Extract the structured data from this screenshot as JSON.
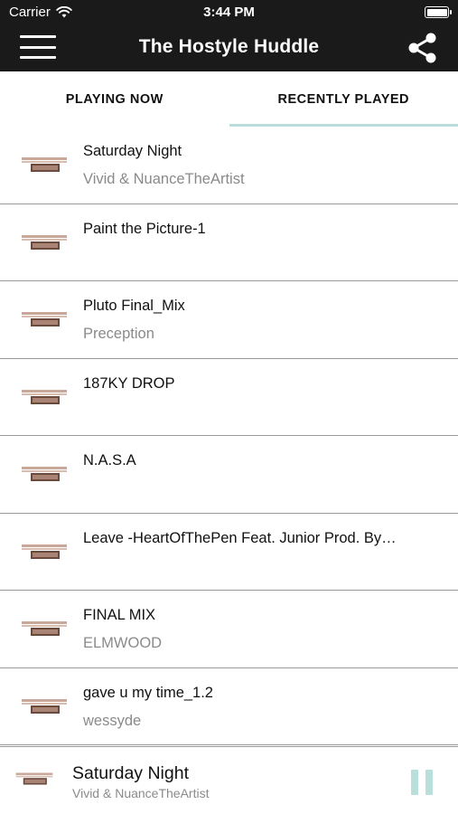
{
  "status_bar": {
    "carrier": "Carrier",
    "time": "3:44 PM",
    "icons": {
      "wifi": "wifi-icon",
      "battery": "battery-icon"
    }
  },
  "nav": {
    "title": "The Hostyle Huddle",
    "menu_icon": "menu-icon",
    "share_icon": "share-icon"
  },
  "tabs": [
    {
      "label": "PLAYING NOW",
      "active": false
    },
    {
      "label": "RECENTLY PLAYED",
      "active": true
    }
  ],
  "colors": {
    "bar_background": "#1a1a1a",
    "accent": "#b9dfdc",
    "divider": "#9a9a9a",
    "secondary_text": "#8a8a8a"
  },
  "tracks": [
    {
      "title": "Saturday Night",
      "artist": "Vivid & NuanceTheArtist"
    },
    {
      "title": "Paint the Picture-1",
      "artist": ""
    },
    {
      "title": "Pluto Final_Mix",
      "artist": "Preception"
    },
    {
      "title": "187KY DROP",
      "artist": ""
    },
    {
      "title": "N.A.S.A",
      "artist": ""
    },
    {
      "title": "Leave -HeartOfThePen Feat. Junior Prod. By…",
      "artist": ""
    },
    {
      "title": "FINAL MIX",
      "artist": "ELMWOOD"
    },
    {
      "title": "gave u my time_1.2",
      "artist": "wessyde"
    }
  ],
  "player": {
    "title": "Saturday Night",
    "artist": "Vivid & NuanceTheArtist",
    "control_icon": "pause-icon"
  }
}
